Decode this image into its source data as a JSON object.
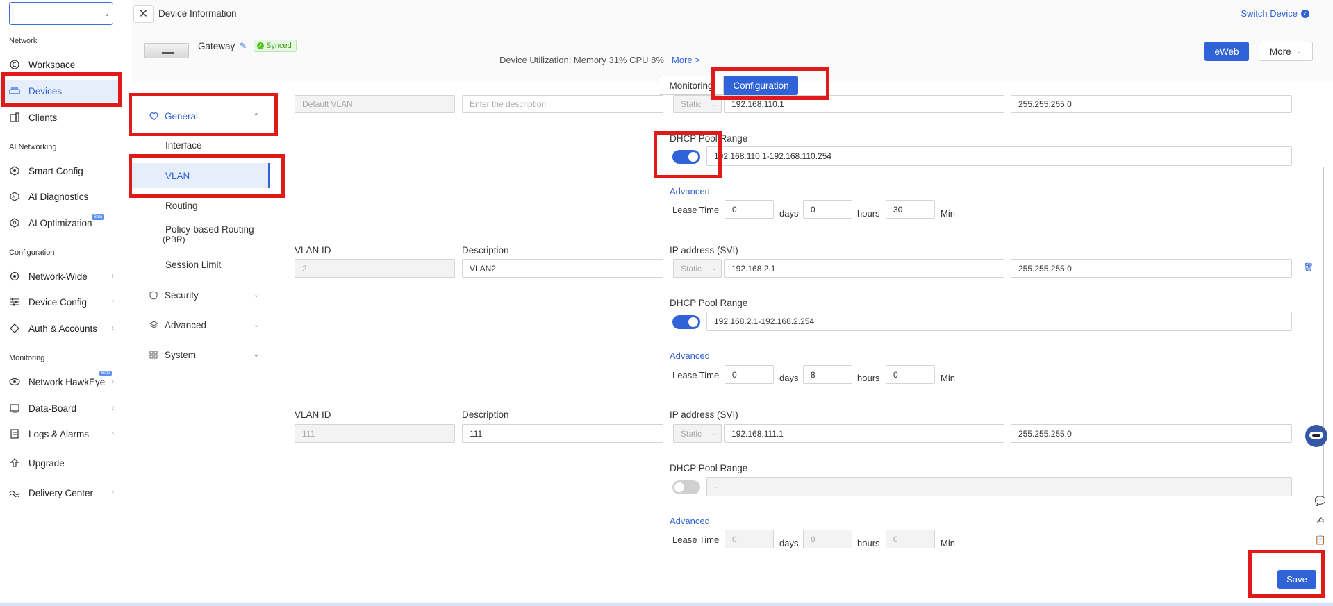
{
  "nav": {
    "search_placeholder": "",
    "sections": {
      "network": "Network",
      "ai": "AI Networking",
      "config": "Configuration",
      "monitoring": "Monitoring"
    },
    "items": {
      "workspace": "Workspace",
      "devices": "Devices",
      "clients": "Clients",
      "smart_config": "Smart Config",
      "ai_diagnostics": "AI Diagnostics",
      "ai_optimization": "AI Optimization",
      "network_wide": "Network-Wide",
      "device_config": "Device Config",
      "auth_accounts": "Auth & Accounts",
      "network_hawkeye": "Network HawkEye",
      "data_board": "Data-Board",
      "logs_alarms": "Logs & Alarms",
      "upgrade": "Upgrade",
      "delivery_center": "Delivery Center"
    },
    "beta_label": "Beta"
  },
  "header": {
    "title": "Device Information",
    "switch_device": "Switch Device",
    "device_name": "Gateway",
    "synced": "Synced",
    "utilization": "Device Utilization: Memory 31% CPU 8%",
    "util_more": "More >",
    "eweb": "eWeb",
    "more": "More",
    "tabs": {
      "monitoring": "Monitoring",
      "configuration": "Configuration"
    }
  },
  "submenu": {
    "general": "General",
    "interface": "Interface",
    "vlan": "VLAN",
    "routing": "Routing",
    "pbr_line1": "Policy-based Routing",
    "pbr_line2": "(PBR)",
    "session_limit": "Session Limit",
    "security": "Security",
    "advanced": "Advanced",
    "system": "System"
  },
  "labels": {
    "vlan_id": "VLAN ID",
    "description": "Description",
    "ip_svi": "IP address (SVI)",
    "dhcp_pool": "DHCP Pool Range",
    "advanced": "Advanced",
    "lease_time": "Lease Time",
    "days": "days",
    "hours": "hours",
    "min": "Min",
    "static": "Static"
  },
  "vlans": [
    {
      "id": "Default VLAN",
      "description": "",
      "desc_placeholder": "Enter the description",
      "ip": "192.168.110.1",
      "mask": "255.255.255.0",
      "dhcp_enabled": true,
      "pool": "192.168.110.1-192.168.110.254",
      "lease_days": "0",
      "lease_hours": "0",
      "lease_min": "30"
    },
    {
      "id": "2",
      "description": "VLAN2",
      "ip": "192.168.2.1",
      "mask": "255.255.255.0",
      "dhcp_enabled": true,
      "pool": "192.168.2.1-192.168.2.254",
      "lease_days": "0",
      "lease_hours": "8",
      "lease_min": "0"
    },
    {
      "id": "111",
      "description": "111",
      "ip": "192.168.111.1",
      "mask": "255.255.255.0",
      "dhcp_enabled": false,
      "pool": "-",
      "lease_days": "0",
      "lease_hours": "8",
      "lease_min": "0"
    }
  ],
  "save": "Save",
  "colors": {
    "accent": "#2f63d7",
    "annotation": "#e01919"
  }
}
